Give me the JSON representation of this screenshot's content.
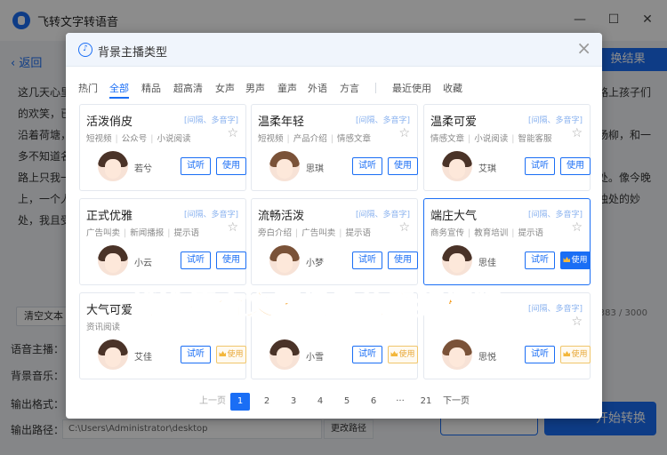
{
  "app": {
    "title": "飞转文字转语音",
    "back_label": "返回",
    "result_label": "换结果",
    "doc_lines": [
      "这几天心里",
      "的欢笑，已",
      "沿着荷塘，",
      "多不知道名",
      "路上只我一",
      "上，一个人",
      "处，我且受"
    ],
    "doc_lines_right": [
      "路上孩子们",
      "杨柳，和一",
      "处。像今晚",
      "独处的妙"
    ],
    "clear_label": "清空文本",
    "char_count": "383 / 3000",
    "voice_label": "语音主播：",
    "bgm_label": "背景音乐：",
    "format_label": "输出格式：",
    "path_label": "输出路径：",
    "path_value": "C:\\Users\\Administrator\\desktop",
    "change_path_label": "更改路径",
    "convert_label": "开始转换"
  },
  "modal": {
    "title": "背景主播类型",
    "categories": [
      "热门",
      "全部",
      "精品",
      "超高清",
      "女声",
      "男声",
      "童声",
      "外语",
      "方言",
      "最近使用",
      "收藏"
    ],
    "active_category": "全部",
    "cards": [
      {
        "name": "活泼俏皮",
        "badge": "[间隔、多音字]",
        "tags": [
          "短视频",
          "公众号",
          "小说阅读"
        ],
        "voice": "若兮",
        "try": "试听",
        "use": "使用",
        "vip": false,
        "hair": "dark"
      },
      {
        "name": "温柔年轻",
        "badge": "[间隔、多音字]",
        "tags": [
          "短视频",
          "产品介绍",
          "情感文章"
        ],
        "voice": "思琪",
        "try": "试听",
        "use": "使用",
        "vip": false,
        "hair": "light"
      },
      {
        "name": "温柔可爱",
        "badge": "[间隔、多音字]",
        "tags": [
          "情感文章",
          "小说阅读",
          "智能客服"
        ],
        "voice": "艾琪",
        "try": "试听",
        "use": "使用",
        "vip": false,
        "hair": "dark"
      },
      {
        "name": "正式优雅",
        "badge": "[间隔、多音字]",
        "tags": [
          "广告叫卖",
          "新闻播报",
          "提示语"
        ],
        "voice": "小云",
        "try": "试听",
        "use": "使用",
        "vip": false,
        "hair": "dark"
      },
      {
        "name": "流畅活泼",
        "badge": "[间隔、多音字]",
        "tags": [
          "旁白介绍",
          "广告叫卖",
          "提示语"
        ],
        "voice": "小梦",
        "try": "试听",
        "use": "使用",
        "vip": false,
        "hair": "light"
      },
      {
        "name": "端庄大气",
        "badge": "[间隔、多音字]",
        "tags": [
          "商务宣传",
          "教育培训",
          "提示语"
        ],
        "voice": "思佳",
        "try": "试听",
        "use": "使用",
        "vip": true,
        "selected": true,
        "hair": "dark"
      },
      {
        "name": "大气可爱",
        "badge": "[间隔、多音字]",
        "tags": [
          "资讯阅读"
        ],
        "voice": "艾佳",
        "try": "试听",
        "use": "使用",
        "vip": true,
        "hair": "dark"
      },
      {
        "name": "",
        "badge": "",
        "tags": [],
        "voice": "小雪",
        "try": "试听",
        "use": "使用",
        "vip": true,
        "hair": "dark"
      },
      {
        "name": "",
        "badge": "[间隔、多音字]",
        "tags": [],
        "voice": "思悦",
        "try": "试听",
        "use": "使用",
        "vip": true,
        "hair": "light"
      }
    ],
    "pagination": {
      "prev": "上一页",
      "pages": [
        "1",
        "2",
        "3",
        "4",
        "5",
        "6",
        "···",
        "21"
      ],
      "current": "1",
      "next": "下一页"
    }
  },
  "caption": "挑选符合文案场景的音频模版",
  "colors": {
    "accent": "#1a6ef5",
    "caption": "#f59a1b",
    "vip": "#e8a93a"
  }
}
